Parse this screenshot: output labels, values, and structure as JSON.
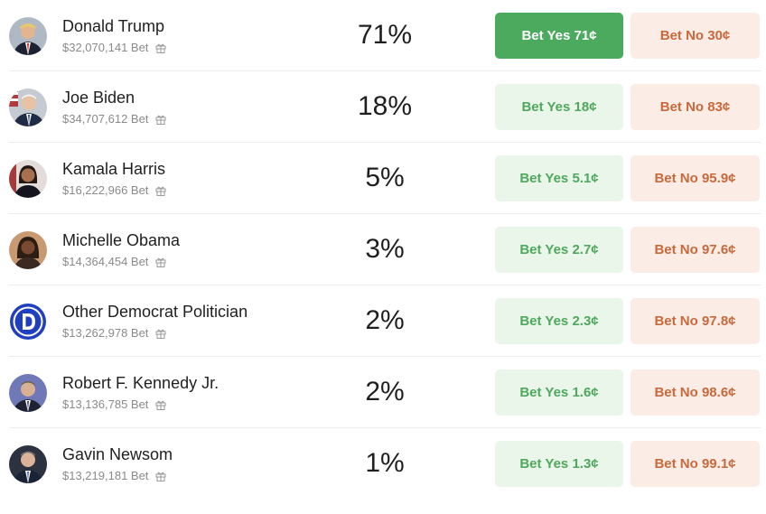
{
  "candidates": [
    {
      "name": "Donald Trump",
      "volume": "$32,070,141 Bet",
      "percent": "71%",
      "yes_label": "Bet Yes 71¢",
      "no_label": "Bet No 30¢",
      "yes_active": true,
      "avatar_color": "#b9c3cc"
    },
    {
      "name": "Joe Biden",
      "volume": "$34,707,612 Bet",
      "percent": "18%",
      "yes_label": "Bet Yes 18¢",
      "no_label": "Bet No 83¢",
      "yes_active": false,
      "avatar_color": "#c9ccd2"
    },
    {
      "name": "Kamala Harris",
      "volume": "$16,222,966 Bet",
      "percent": "5%",
      "yes_label": "Bet Yes 5.1¢",
      "no_label": "Bet No 95.9¢",
      "yes_active": false,
      "avatar_color": "#d8d0cc"
    },
    {
      "name": "Michelle Obama",
      "volume": "$14,364,454 Bet",
      "percent": "3%",
      "yes_label": "Bet Yes 2.7¢",
      "no_label": "Bet No 97.6¢",
      "yes_active": false,
      "avatar_color": "#b78766"
    },
    {
      "name": "Other Democrat Politician",
      "volume": "$13,262,978 Bet",
      "percent": "2%",
      "yes_label": "Bet Yes 2.3¢",
      "no_label": "Bet No 97.8¢",
      "yes_active": false,
      "avatar_color": "#ffffff"
    },
    {
      "name": "Robert F. Kennedy Jr.",
      "volume": "$13,136,785 Bet",
      "percent": "2%",
      "yes_label": "Bet Yes 1.6¢",
      "no_label": "Bet No 98.6¢",
      "yes_active": false,
      "avatar_color": "#7b83b8"
    },
    {
      "name": "Gavin Newsom",
      "volume": "$13,219,181 Bet",
      "percent": "1%",
      "yes_label": "Bet Yes 1.3¢",
      "no_label": "Bet No 99.1¢",
      "yes_active": false,
      "avatar_color": "#3a3f4a"
    }
  ],
  "colors": {
    "yes_active_bg": "#4caa5e",
    "yes_bg": "#eaf6ea",
    "yes_text": "#4ea85d",
    "no_bg": "#fbece6",
    "no_text": "#c8693c",
    "democrat_logo_blue": "#1f3fbf"
  },
  "icons": {
    "avatar": "portrait-photo",
    "democrat_avatar": "democrat-d-logo",
    "volume_extra": "gift-icon"
  }
}
